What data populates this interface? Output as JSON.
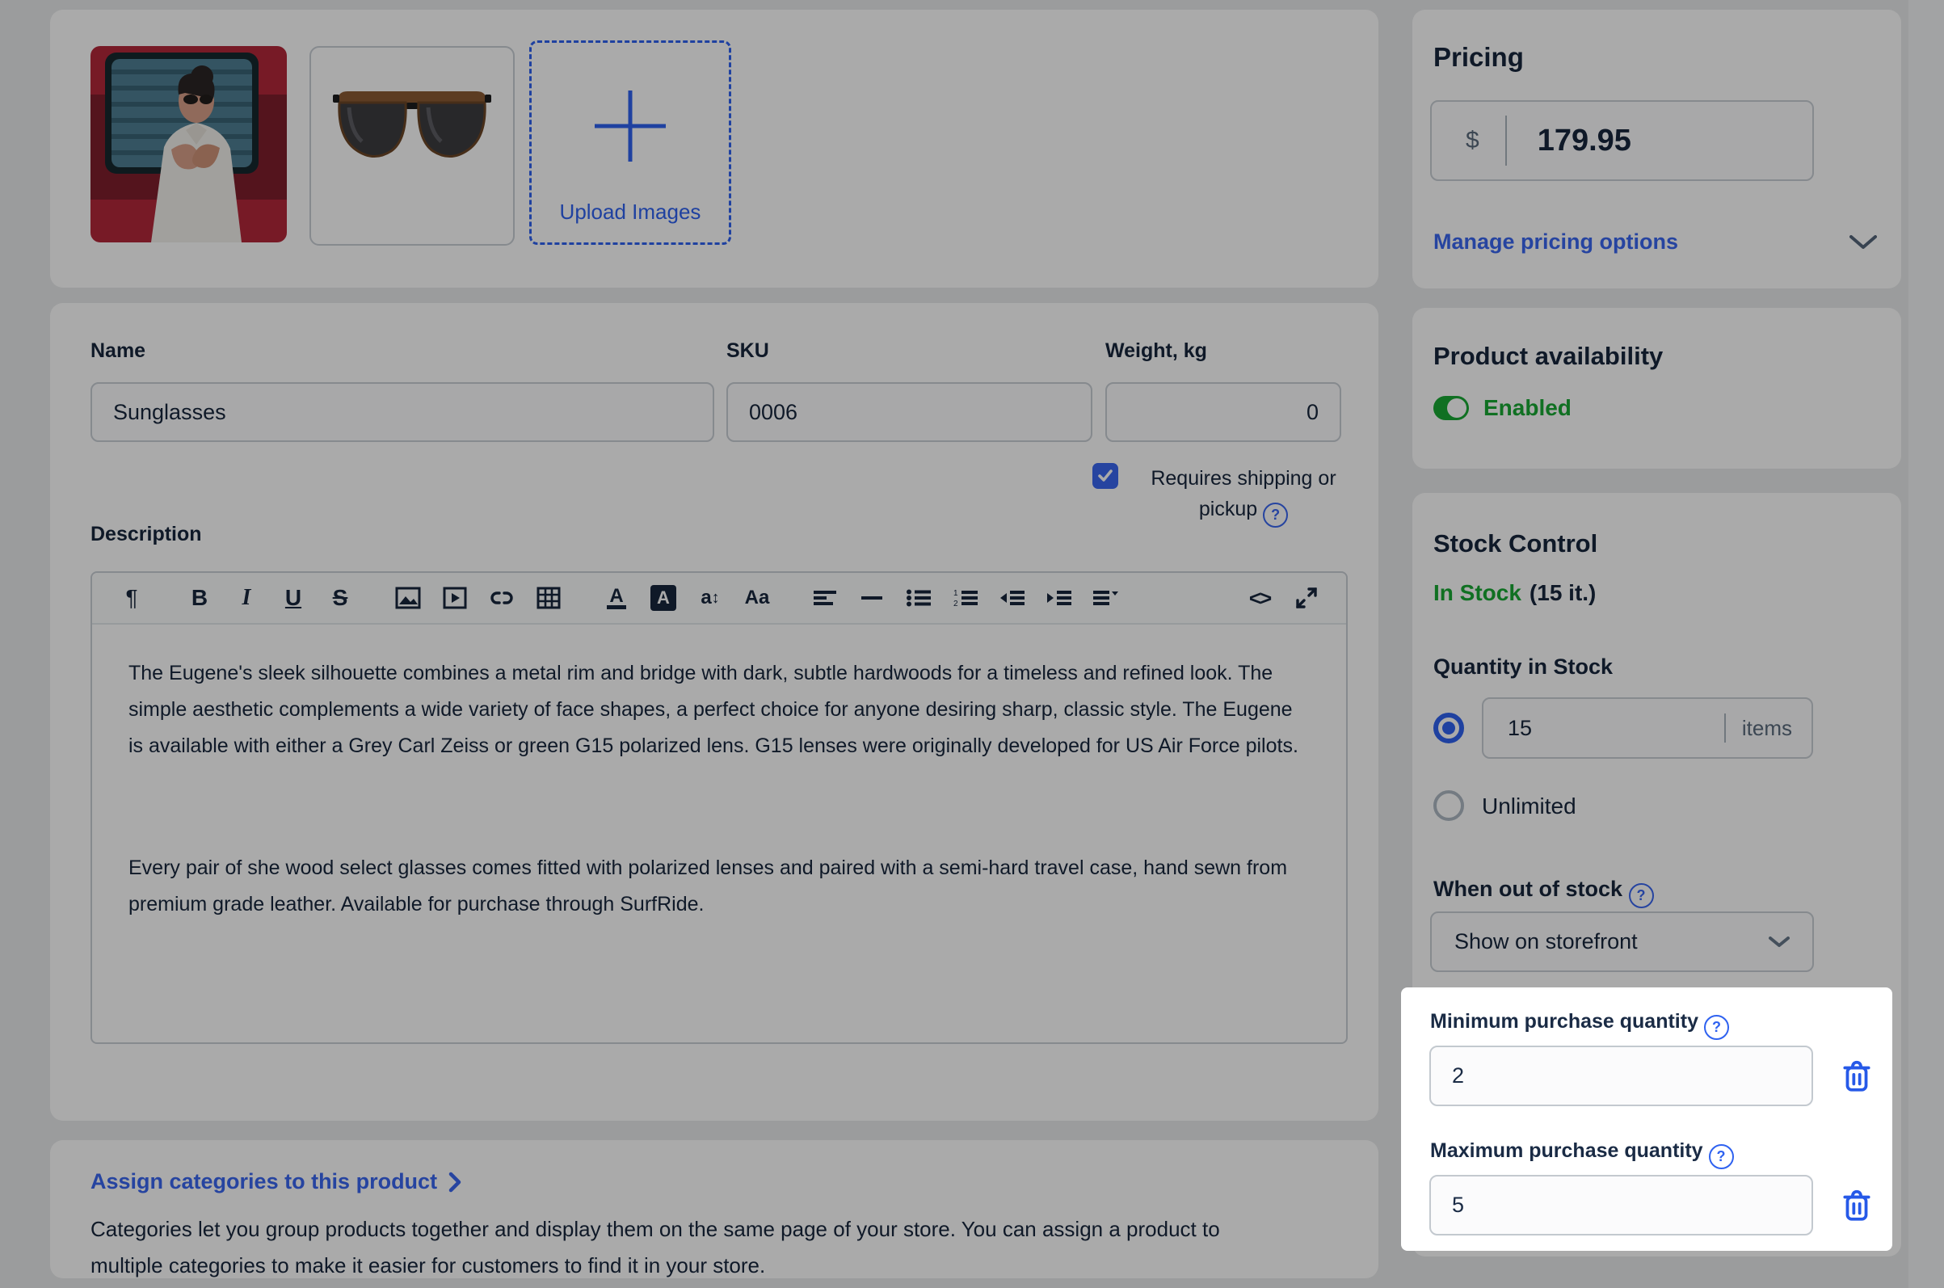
{
  "images_card": {
    "upload_label": "Upload Images"
  },
  "details_card": {
    "name_label": "Name",
    "name_value": "Sunglasses",
    "sku_label": "SKU",
    "sku_value": "0006",
    "weight_label": "Weight, kg",
    "weight_value": "0",
    "shipping_line1": "Requires shipping or",
    "shipping_line2": "pickup",
    "help_glyph": "?",
    "description_label": "Description",
    "description_p1": "The Eugene's sleek silhouette combines a metal rim and bridge with dark, subtle hardwoods for a timeless and refined look. The simple aesthetic complements a wide variety of face shapes, a perfect choice for anyone desiring sharp, classic style. The Eugene is available with either a Grey Carl Zeiss or green G15 polarized lens. G15 lenses were originally developed for US Air Force pilots.",
    "description_p2": "Every pair of she wood select glasses comes fitted with polarized lenses and paired with a semi-hard travel case, hand sewn from premium grade leather. Available for purchase through SurfRide.",
    "toolbar": {
      "pilcrow": "¶",
      "bold": "B",
      "italic": "I",
      "underline": "U",
      "strike": "S",
      "text_color": "A",
      "bg_color": "A",
      "font_size": "a",
      "font_case": "Aa",
      "code": "<>"
    }
  },
  "categories_card": {
    "link_label": "Assign categories to this product",
    "body": "Categories let you group products together and display them on the same page of your store. You can assign a product to multiple categories to make it easier for customers to find it in your store."
  },
  "pricing_card": {
    "title": "Pricing",
    "currency": "$",
    "price": "179.95",
    "manage_label": "Manage pricing options"
  },
  "availability_card": {
    "title": "Product availability",
    "status": "Enabled"
  },
  "stock_card": {
    "title": "Stock Control",
    "in_stock_label": "In Stock",
    "in_stock_count": "(15 it.)",
    "quantity_label": "Quantity in Stock",
    "quantity_value": "15",
    "quantity_units": "items",
    "unlimited_label": "Unlimited",
    "out_of_stock_label": "When out of stock",
    "out_of_stock_value": "Show on storefront",
    "help_glyph": "?"
  },
  "spotlight": {
    "min_label": "Minimum purchase quantity",
    "min_value": "2",
    "max_label": "Maximum purchase quantity",
    "max_value": "5",
    "help_glyph": "?"
  },
  "colors": {
    "accent_blue": "#3a66f0",
    "bright_blue": "#2659e8",
    "green": "#18a834",
    "navy": "#17263c"
  }
}
